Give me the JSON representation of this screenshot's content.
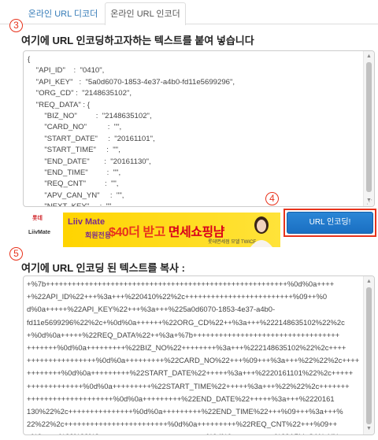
{
  "tabs": [
    {
      "label": "온라인 URL 디코더"
    },
    {
      "label": "온라인 URL 인코더"
    }
  ],
  "steps": {
    "s3": "3",
    "s4": "4",
    "s5": "5"
  },
  "input_section": {
    "heading": "여기에 URL 인코딩하고자하는 텍스트를 붙여 넣습니다",
    "value": "{\n    \"API_ID\"    :  \"0410\",\n    \"API_KEY\"   :  \"5a0d6070-1853-4e37-a4b0-fd11e5699296\",\n    \"ORG_CD\" :  \"2148635102\",\n    \"REQ_DATA\" : {\n        \"BIZ_NO\"         :  \"2148635102\",\n        \"CARD_NO\"          :  \"\",\n        \"START_DATE\"     :  \"20161101\",\n        \"START_TIME\"     :  \"\",\n        \"END_DATE\"       :  \"20161130\",\n        \"END_TIME\"         :  \"\",\n        \"REQ_CNT\"         :  \"\",\n        \"APV_CAN_YN\"     :  \"\",\n        \"NEXT_KEY\"     :  \"\""
  },
  "ad": {
    "logo_brand": "롯데",
    "logo_mate": "LiivMate",
    "brand_line1": "Liiv Mate",
    "brand_line2": "회원전용",
    "brand_line3": "",
    "promo_amount": "$40",
    "promo_text": "더 받고",
    "promo_highlight": "면세쇼핑냠",
    "small_text": "롯데면세점 모델 TWICE"
  },
  "encode_button": {
    "label": "URL 인코딩!"
  },
  "output_section": {
    "heading": "여기에 URL 인코딩 된 텍스트를 복사 :",
    "value": "+%7b++++++++++++++++++++++++++++++++++++++++++++++++++++++++%0d%0a++++\n+%22API_ID%22+++%3a+++%220410%22%2c+++++++++++++++++++++++++%09++%0\nd%0a+++++%22API_KEY%22+++%3a+++%225a0d6070-1853-4e37-a4b0-\nfd11e5699296%22%2c+%0d%0a++++++%22ORG_CD%22++%3a+++%222148635102%22%2c\n+%0d%0a+++++%22REQ_DATA%22++%3a+%7b++++++++++++++++++++++++++++++++++\n+++++++%0d%0a+++++++++%22BIZ_NO%22++++++++%3a+++%222148635102%22%2c++++\n++++++++++++++++%0d%0a+++++++++%22CARD_NO%22+++%09+++%3a+++%22%22%2c++++\n++++++++%0d%0a+++++++++%22START_DATE%22+++++%3a+++%2220161101%22%2c+++++\n+++++++++++++%0d%0a+++++++++%22START_TIME%22+++++%3a+++%22%22%2c+++++++\n++++++++++++++++++++%0d%0a+++++++++%22END_DATE%22+++++%3a+++%2220161\n130%22%2c+++++++++++++++%0d%0a+++++++++%22END_TIME%22+++%09+++%3a+++%\n22%22%2c++++++++++++++++++++++++%0d%0a+++++++++%22REQ_CNT%22+++%09++\n+%3a+++%22%22%2c++++++++++++++++++++++++%0d%0a+++++++++%22APV_CAN_YN\n%22+++++%3a+++%22%22%2c+++++++++++++++++++++%0d%0a+++++++++%22NE"
  },
  "colors": {
    "accent": "#e8331c",
    "button": "#1a6fc2",
    "link": "#337ab7"
  }
}
